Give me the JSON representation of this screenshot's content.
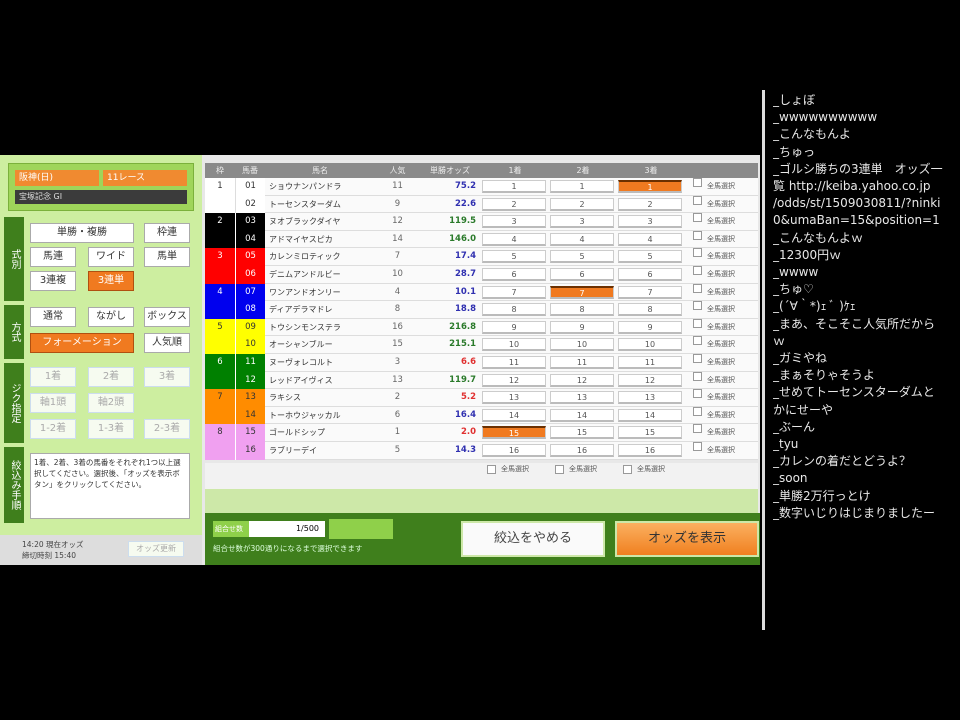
{
  "race": {
    "venue": "阪神(日)",
    "race_no": "11レース",
    "name": "宝塚記念 GI"
  },
  "sections": {
    "bet_type": "式別",
    "method": "方式",
    "axis": "ジク指定",
    "steps": "絞込み手順"
  },
  "bet_types": [
    "単勝・複勝",
    "枠連",
    "馬連",
    "ワイド",
    "馬単",
    "3連複",
    "3連単"
  ],
  "bet_type_selected": "3連単",
  "methods": [
    "通常",
    "ながし",
    "ボックス",
    "フォーメーション",
    "人気順"
  ],
  "method_selected": "フォーメーション",
  "axis_buttons": [
    "1着",
    "2着",
    "3着",
    "軸1頭",
    "軸2頭",
    "1-2着",
    "1-3着",
    "2-3着"
  ],
  "instructions": "1着、2着、3着の馬番をそれぞれ1つ以上選択してください。選択後、「オッズを表示ボタン」をクリックしてください。",
  "odds_time": "14:20 現在オッズ",
  "deadline": "締切時刻 15:40",
  "refresh_label": "オッズ更新",
  "headers": {
    "frame": "枠",
    "num": "馬番",
    "name": "馬名",
    "pop": "人気",
    "odds": "単勝オッズ",
    "first": "1着",
    "second": "2着",
    "third": "3着"
  },
  "frame_colors": [
    "#ffffff",
    "#000000",
    "#ff0000",
    "#0000ee",
    "#ffff00",
    "#008000",
    "#ff8c00",
    "#f0a0f0"
  ],
  "horses": [
    {
      "frame": "1",
      "num": "01",
      "name": "ショウナンパンドラ",
      "pop": "11",
      "odds": "75.2"
    },
    {
      "frame": "",
      "num": "02",
      "name": "トーセンスターダム",
      "pop": "9",
      "odds": "22.6"
    },
    {
      "frame": "2",
      "num": "03",
      "name": "ヌオブラックダイヤ",
      "pop": "12",
      "odds": "119.5"
    },
    {
      "frame": "",
      "num": "04",
      "name": "アドマイヤスピカ",
      "pop": "14",
      "odds": "146.0"
    },
    {
      "frame": "3",
      "num": "05",
      "name": "カレンミロティック",
      "pop": "7",
      "odds": "17.4"
    },
    {
      "frame": "",
      "num": "06",
      "name": "デニムアンドルビー",
      "pop": "10",
      "odds": "28.7"
    },
    {
      "frame": "4",
      "num": "07",
      "name": "ワンアンドオンリー",
      "pop": "4",
      "odds": "10.1"
    },
    {
      "frame": "",
      "num": "08",
      "name": "ディアデラマドレ",
      "pop": "8",
      "odds": "18.8"
    },
    {
      "frame": "5",
      "num": "09",
      "name": "トウシンモンステラ",
      "pop": "16",
      "odds": "216.8"
    },
    {
      "frame": "",
      "num": "10",
      "name": "オーシャンブルー",
      "pop": "15",
      "odds": "215.1"
    },
    {
      "frame": "6",
      "num": "11",
      "name": "ヌーヴォレコルト",
      "pop": "3",
      "odds": "6.6"
    },
    {
      "frame": "",
      "num": "12",
      "name": "レッドアイヴィス",
      "pop": "13",
      "odds": "119.7"
    },
    {
      "frame": "7",
      "num": "13",
      "name": "ラキシス",
      "pop": "2",
      "odds": "5.2"
    },
    {
      "frame": "",
      "num": "14",
      "name": "トーホウジャッカル",
      "pop": "6",
      "odds": "16.4"
    },
    {
      "frame": "8",
      "num": "15",
      "name": "ゴールドシップ",
      "pop": "1",
      "odds": "2.0"
    },
    {
      "frame": "",
      "num": "16",
      "name": "ラブリーデイ",
      "pop": "5",
      "odds": "14.3"
    }
  ],
  "selected": {
    "first": [
      "15"
    ],
    "second": [
      "07"
    ],
    "third": [
      "01"
    ]
  },
  "select_all_label": "全馬選択",
  "combo_label": "組合せ数",
  "combo_value": "1/500",
  "combo_note": "組合せ数が300通りになるまで選択できます",
  "cancel_label": "絞込をやめる",
  "show_odds_label": "オッズを表示",
  "comments": [
    "_しょぼ",
    "_wwwwwwwwww",
    "_こんなもんよ",
    "_ちゅっ",
    "_ゴルシ勝ちの3連単　オッズ一",
    "覧 http://keiba.yahoo.co.jp",
    "/odds/st/1509030811/?ninki",
    "0&umaBan=15&position=1",
    "_こんなもんよｗ",
    "_12300円ｗ",
    "_wwww",
    "_ちゅ♡",
    "_(´∀｀*)ｪ ﾞ )ｹｪ",
    "_まあ、そこそこ人気所だから",
    "ｗ",
    "_ガミやね",
    "_まぁそりゃそうよ",
    "_せめてトーセンスターダムと",
    "かにせーや",
    "_ぶーん",
    "_tyu",
    "_カレンの着だとどうよ？",
    "_soon",
    "_単勝2万行っとけ",
    "_数字いじりはじまりましたー"
  ]
}
